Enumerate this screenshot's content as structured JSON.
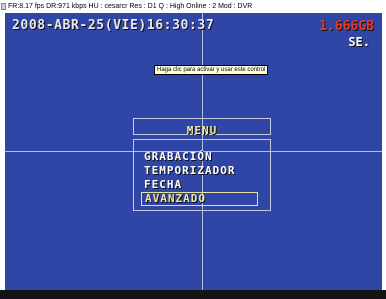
{
  "status_bar": {
    "text": "FR:8.17 fps  DR:971 kbps  HU : cesarcr  Res : D1  Q : High  Online : 2 Mod : DVR"
  },
  "osd": {
    "datetime": "2008-ABR-25(VIE)16:30:37",
    "storage": "1.666GB",
    "day_code": "SE."
  },
  "tooltip": {
    "text": "Haga clic para activar y usar este control"
  },
  "menu": {
    "title": "MENU",
    "items": [
      {
        "label": "GRABACIÓN"
      },
      {
        "label": "TEMPORIZADOR"
      },
      {
        "label": "FECHA"
      },
      {
        "label": "AVANZADO"
      }
    ],
    "selected_index": 3
  },
  "colors": {
    "video_background": "#2f46a6",
    "storage_text": "#e03a2a",
    "menu_highlight": "#ece8a0"
  }
}
